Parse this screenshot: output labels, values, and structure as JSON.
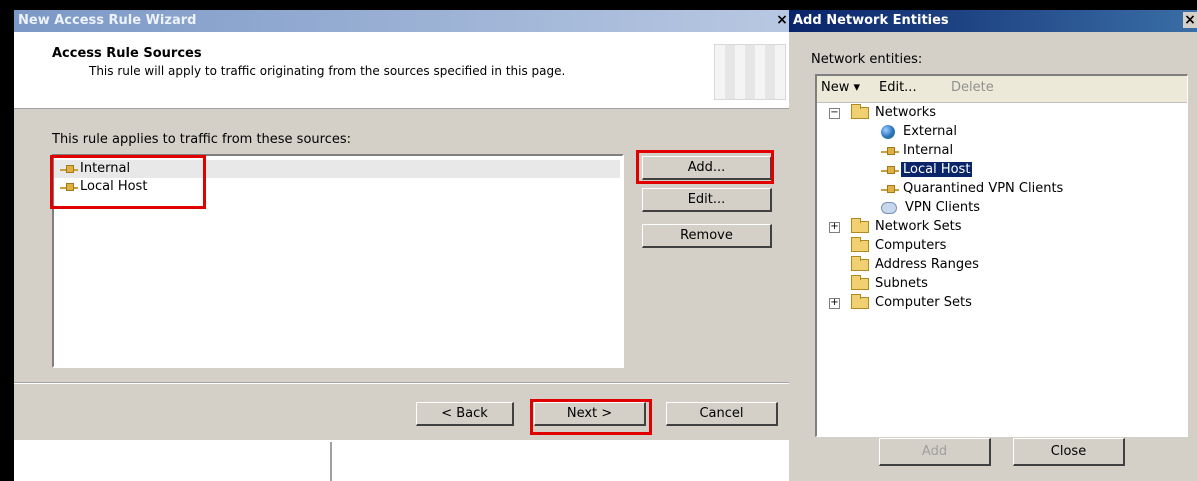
{
  "wizard": {
    "title": "New Access Rule Wizard",
    "close_glyph": "×",
    "heading": "Access Rule Sources",
    "description": "This rule will apply to traffic originating from the sources specified in this page.",
    "sources_label": "This rule applies to traffic from these sources:",
    "sources": [
      "Internal",
      "Local Host"
    ],
    "buttons": {
      "add": "Add...",
      "edit": "Edit...",
      "remove": "Remove",
      "back": "< Back",
      "next": "Next >",
      "cancel": "Cancel"
    }
  },
  "dialog": {
    "title": "Add Network Entities",
    "close_glyph": "×",
    "entities_label": "Network entities:",
    "toolbar": {
      "new": "New",
      "new_arrow": "▾",
      "edit": "Edit...",
      "delete": "Delete"
    },
    "tree": {
      "networks": "Networks",
      "networks_children": [
        "External",
        "Internal",
        "Local Host",
        "Quarantined VPN Clients",
        "VPN Clients"
      ],
      "selected": "Local Host",
      "network_sets": "Network Sets",
      "computers": "Computers",
      "address_ranges": "Address Ranges",
      "subnets": "Subnets",
      "computer_sets": "Computer Sets"
    },
    "buttons": {
      "add": "Add",
      "close": "Close"
    }
  },
  "colors": {
    "highlight_box": "#e00000",
    "selection": "#0a246a"
  }
}
